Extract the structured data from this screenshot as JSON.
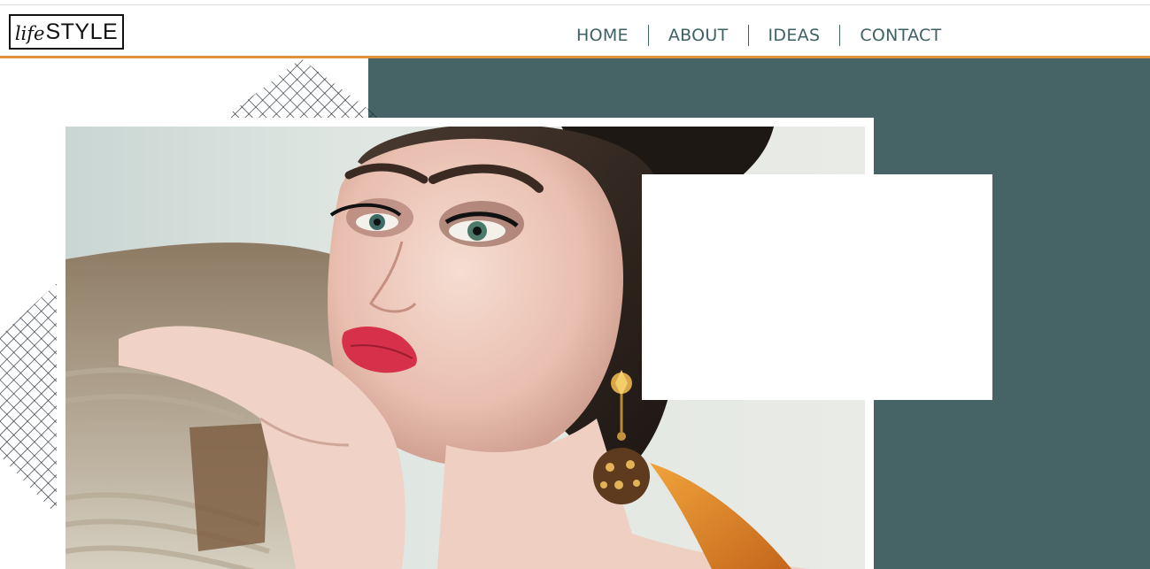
{
  "logo": {
    "script": "life",
    "caps": "STYLE"
  },
  "nav": {
    "items": [
      {
        "label": "HOME"
      },
      {
        "label": "ABOUT"
      },
      {
        "label": "IDEAS"
      },
      {
        "label": "CONTACT"
      }
    ]
  },
  "colors": {
    "accent": "#e0923a",
    "panel": "#466466",
    "nav_text": "#3e6163"
  }
}
